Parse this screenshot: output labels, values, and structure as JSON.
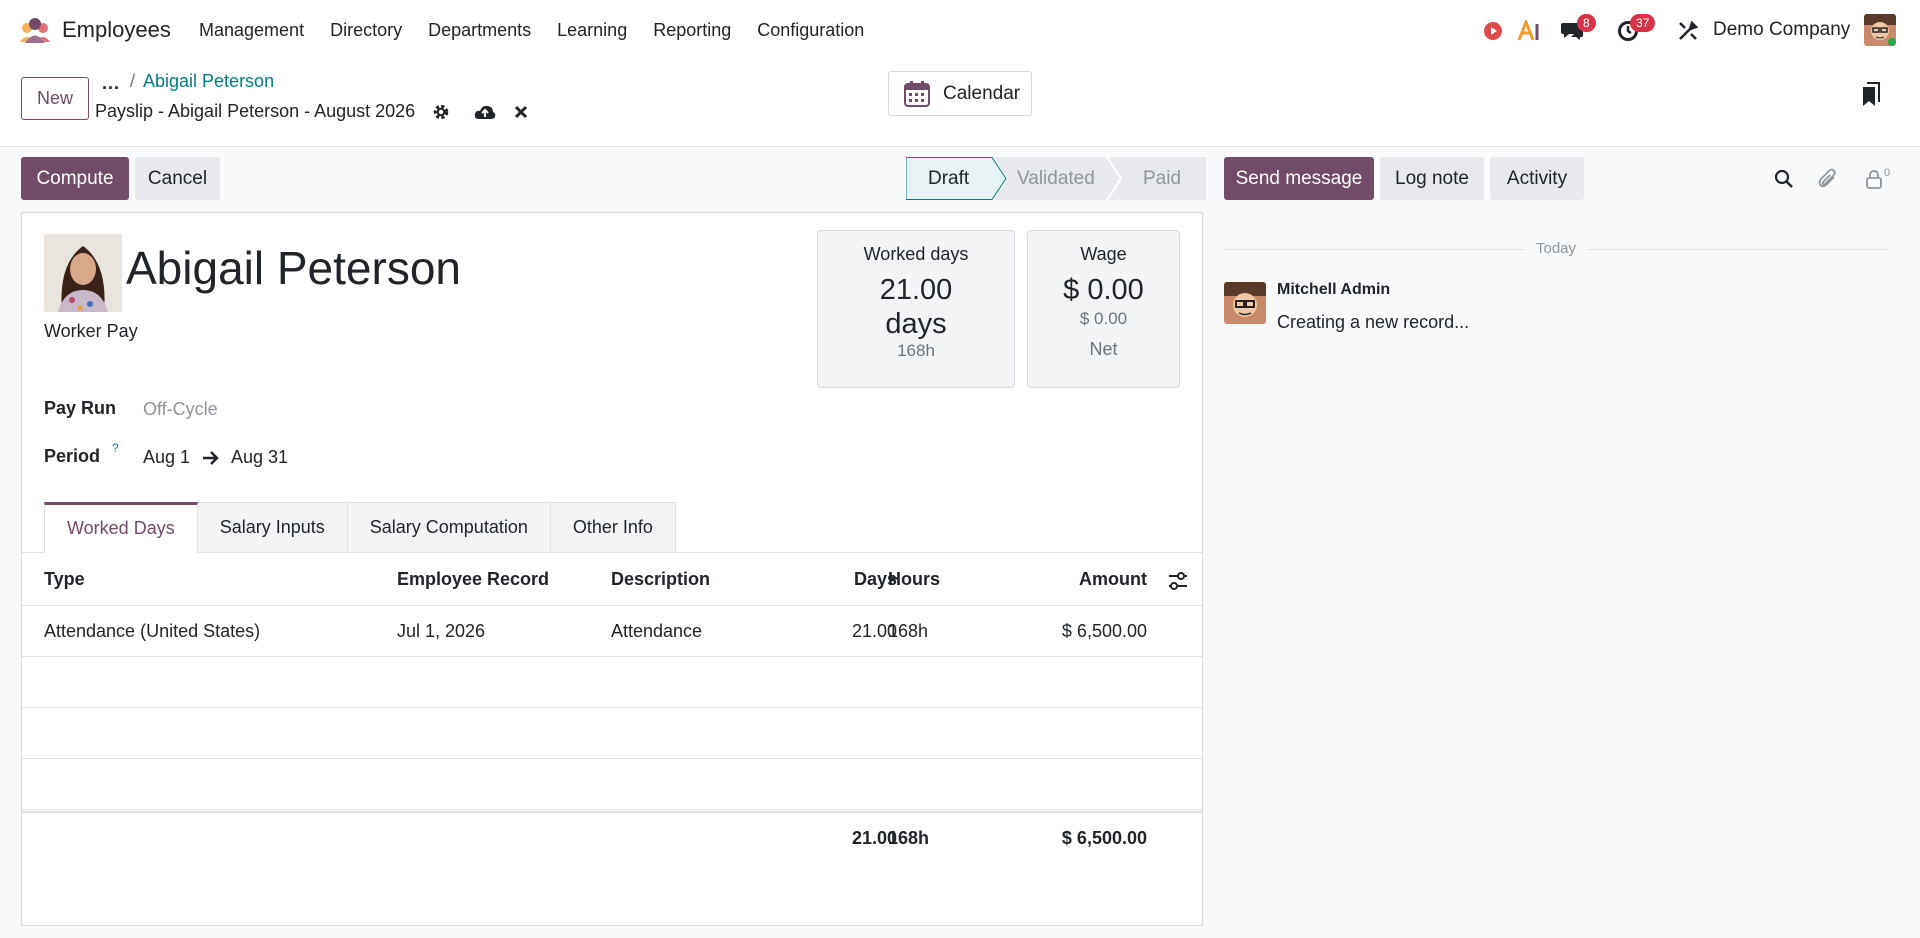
{
  "navbar": {
    "app_name": "Employees",
    "menu": [
      "Management",
      "Directory",
      "Departments",
      "Learning",
      "Reporting",
      "Configuration"
    ],
    "messages_count": "8",
    "activities_count": "37",
    "company": "Demo Company"
  },
  "control": {
    "new_label": "New",
    "breadcrumb_more": "...",
    "breadcrumb_sep": "/",
    "breadcrumb_parent": "Abigail Peterson",
    "record_title": "Payslip - Abigail Peterson - August 2026",
    "calendar_label": "Calendar"
  },
  "actions": {
    "compute_label": "Compute",
    "cancel_label": "Cancel"
  },
  "statusbar": {
    "stages": [
      "Draft",
      "Validated",
      "Paid"
    ],
    "current": "Draft"
  },
  "form": {
    "employee_name": "Abigail Peterson",
    "structure": "Worker Pay",
    "pay_run_label": "Pay Run",
    "pay_run_placeholder": "Off-Cycle",
    "period_label": "Period",
    "period_help": "?",
    "period_start": "Aug 1",
    "period_end": "Aug 31",
    "worked_days_box": {
      "title": "Worked days",
      "value": "21.00",
      "unit": "days",
      "hours": "168h"
    },
    "wage_box": {
      "title": "Wage",
      "value": "$ 0.00",
      "sub": "$ 0.00",
      "label": "Net"
    }
  },
  "tabs": [
    "Worked Days",
    "Salary Inputs",
    "Salary Computation",
    "Other Info"
  ],
  "worked_days_table": {
    "headers": {
      "type": "Type",
      "record": "Employee Record",
      "description": "Description",
      "days": "Days",
      "hours": "Hours",
      "amount": "Amount"
    },
    "rows": [
      {
        "type": "Attendance (United States)",
        "record": "Jul 1, 2026",
        "description": "Attendance",
        "days": "21.00",
        "hours": "168h",
        "amount": "$ 6,500.00"
      }
    ],
    "totals": {
      "days": "21.00",
      "hours": "168h",
      "amount": "$ 6,500.00"
    }
  },
  "chatter": {
    "send_message_label": "Send message",
    "log_note_label": "Log note",
    "activity_label": "Activity",
    "followers_count": "0",
    "date_separator": "Today",
    "messages": [
      {
        "author": "Mitchell Admin",
        "body": "Creating a new record..."
      }
    ]
  },
  "colors": {
    "brand": "#714b67",
    "teal": "#017e84",
    "badge": "#d9334a"
  }
}
